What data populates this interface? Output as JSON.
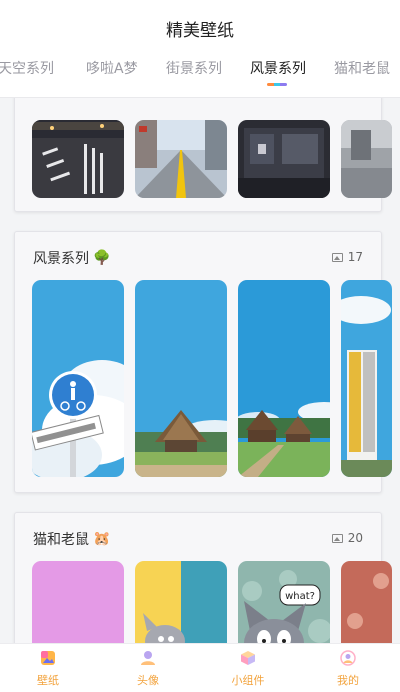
{
  "header": {
    "title": "精美壁纸",
    "tabs": [
      {
        "label": "天空系列",
        "active": false
      },
      {
        "label": "哆啦A梦",
        "active": false
      },
      {
        "label": "街景系列",
        "active": false
      },
      {
        "label": "风景系列",
        "active": true
      },
      {
        "label": "猫和老鼠",
        "active": false
      }
    ],
    "indicator_colors": [
      "#ff8a3d",
      "#3dc7e8",
      "#8c7bf0"
    ]
  },
  "sections": [
    {
      "name": "",
      "emoji": "",
      "count": "",
      "thumbs": [
        "night crossing street",
        "street with yellow center line",
        "shopfront at night",
        "partial street"
      ]
    },
    {
      "name": "风景系列",
      "emoji": "🌳",
      "count": "17",
      "thumbs": [
        "road sign against blue sky",
        "thatched village under blue sky",
        "wooden houses with green field",
        "partial signboard"
      ]
    },
    {
      "name": "猫和老鼠",
      "emoji": "🐹",
      "count": "20",
      "thumbs": [
        "pink background",
        "cat and mouse on yellow and blue",
        "cat saying what?",
        "partial red pattern"
      ]
    }
  ],
  "bubble_text": "what?",
  "tabbar": {
    "items": [
      {
        "label": "壁纸",
        "icon": "wallpaper-icon"
      },
      {
        "label": "头像",
        "icon": "avatar-icon"
      },
      {
        "label": "小组件",
        "icon": "widget-icon"
      },
      {
        "label": "我的",
        "icon": "profile-icon"
      }
    ],
    "label_color": "#f2a33d"
  },
  "colors": {
    "accent": "#f2a33d",
    "sky_blue": "#3fa6de"
  }
}
